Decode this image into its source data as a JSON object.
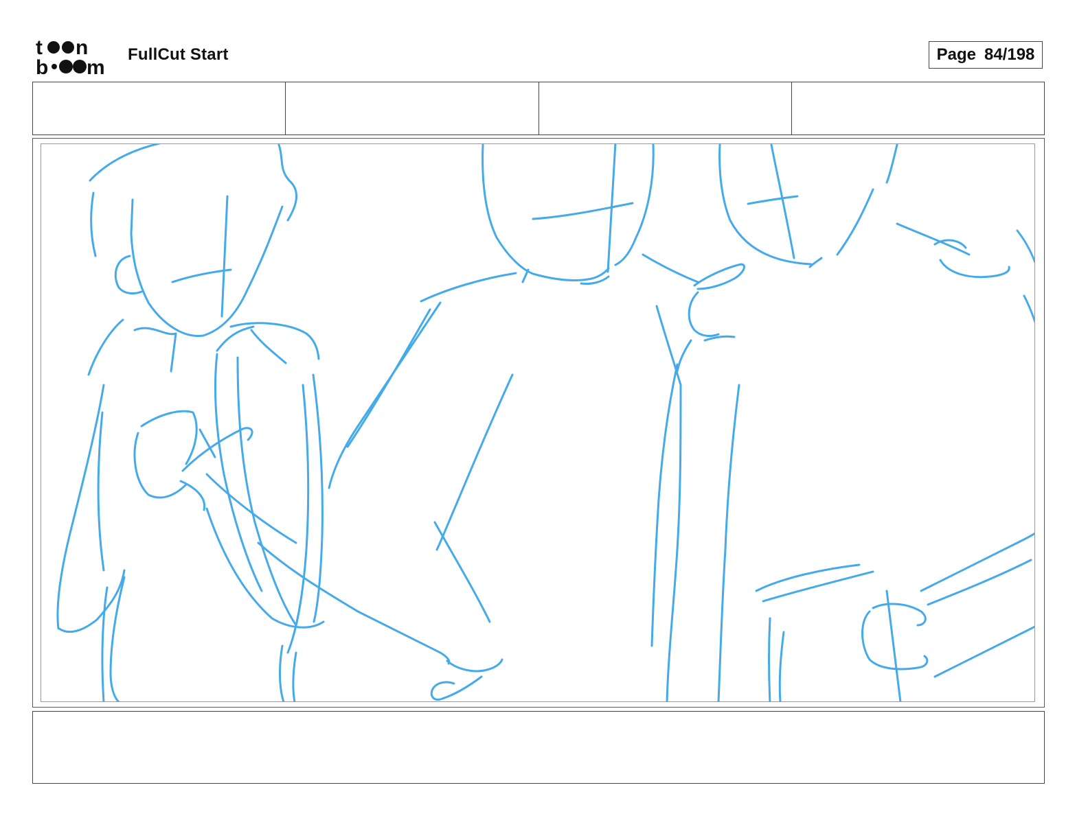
{
  "header": {
    "logo_text": "toonboom",
    "project_title": "FullCut Start",
    "page_label": "Page",
    "page_number": "84/198"
  },
  "header_fields": [
    "",
    "",
    "",
    ""
  ],
  "panel": {
    "sketch_color": "#3aa6e8",
    "content": "blue rough storyboard sketch of figures"
  },
  "notes": {
    "text": ""
  }
}
